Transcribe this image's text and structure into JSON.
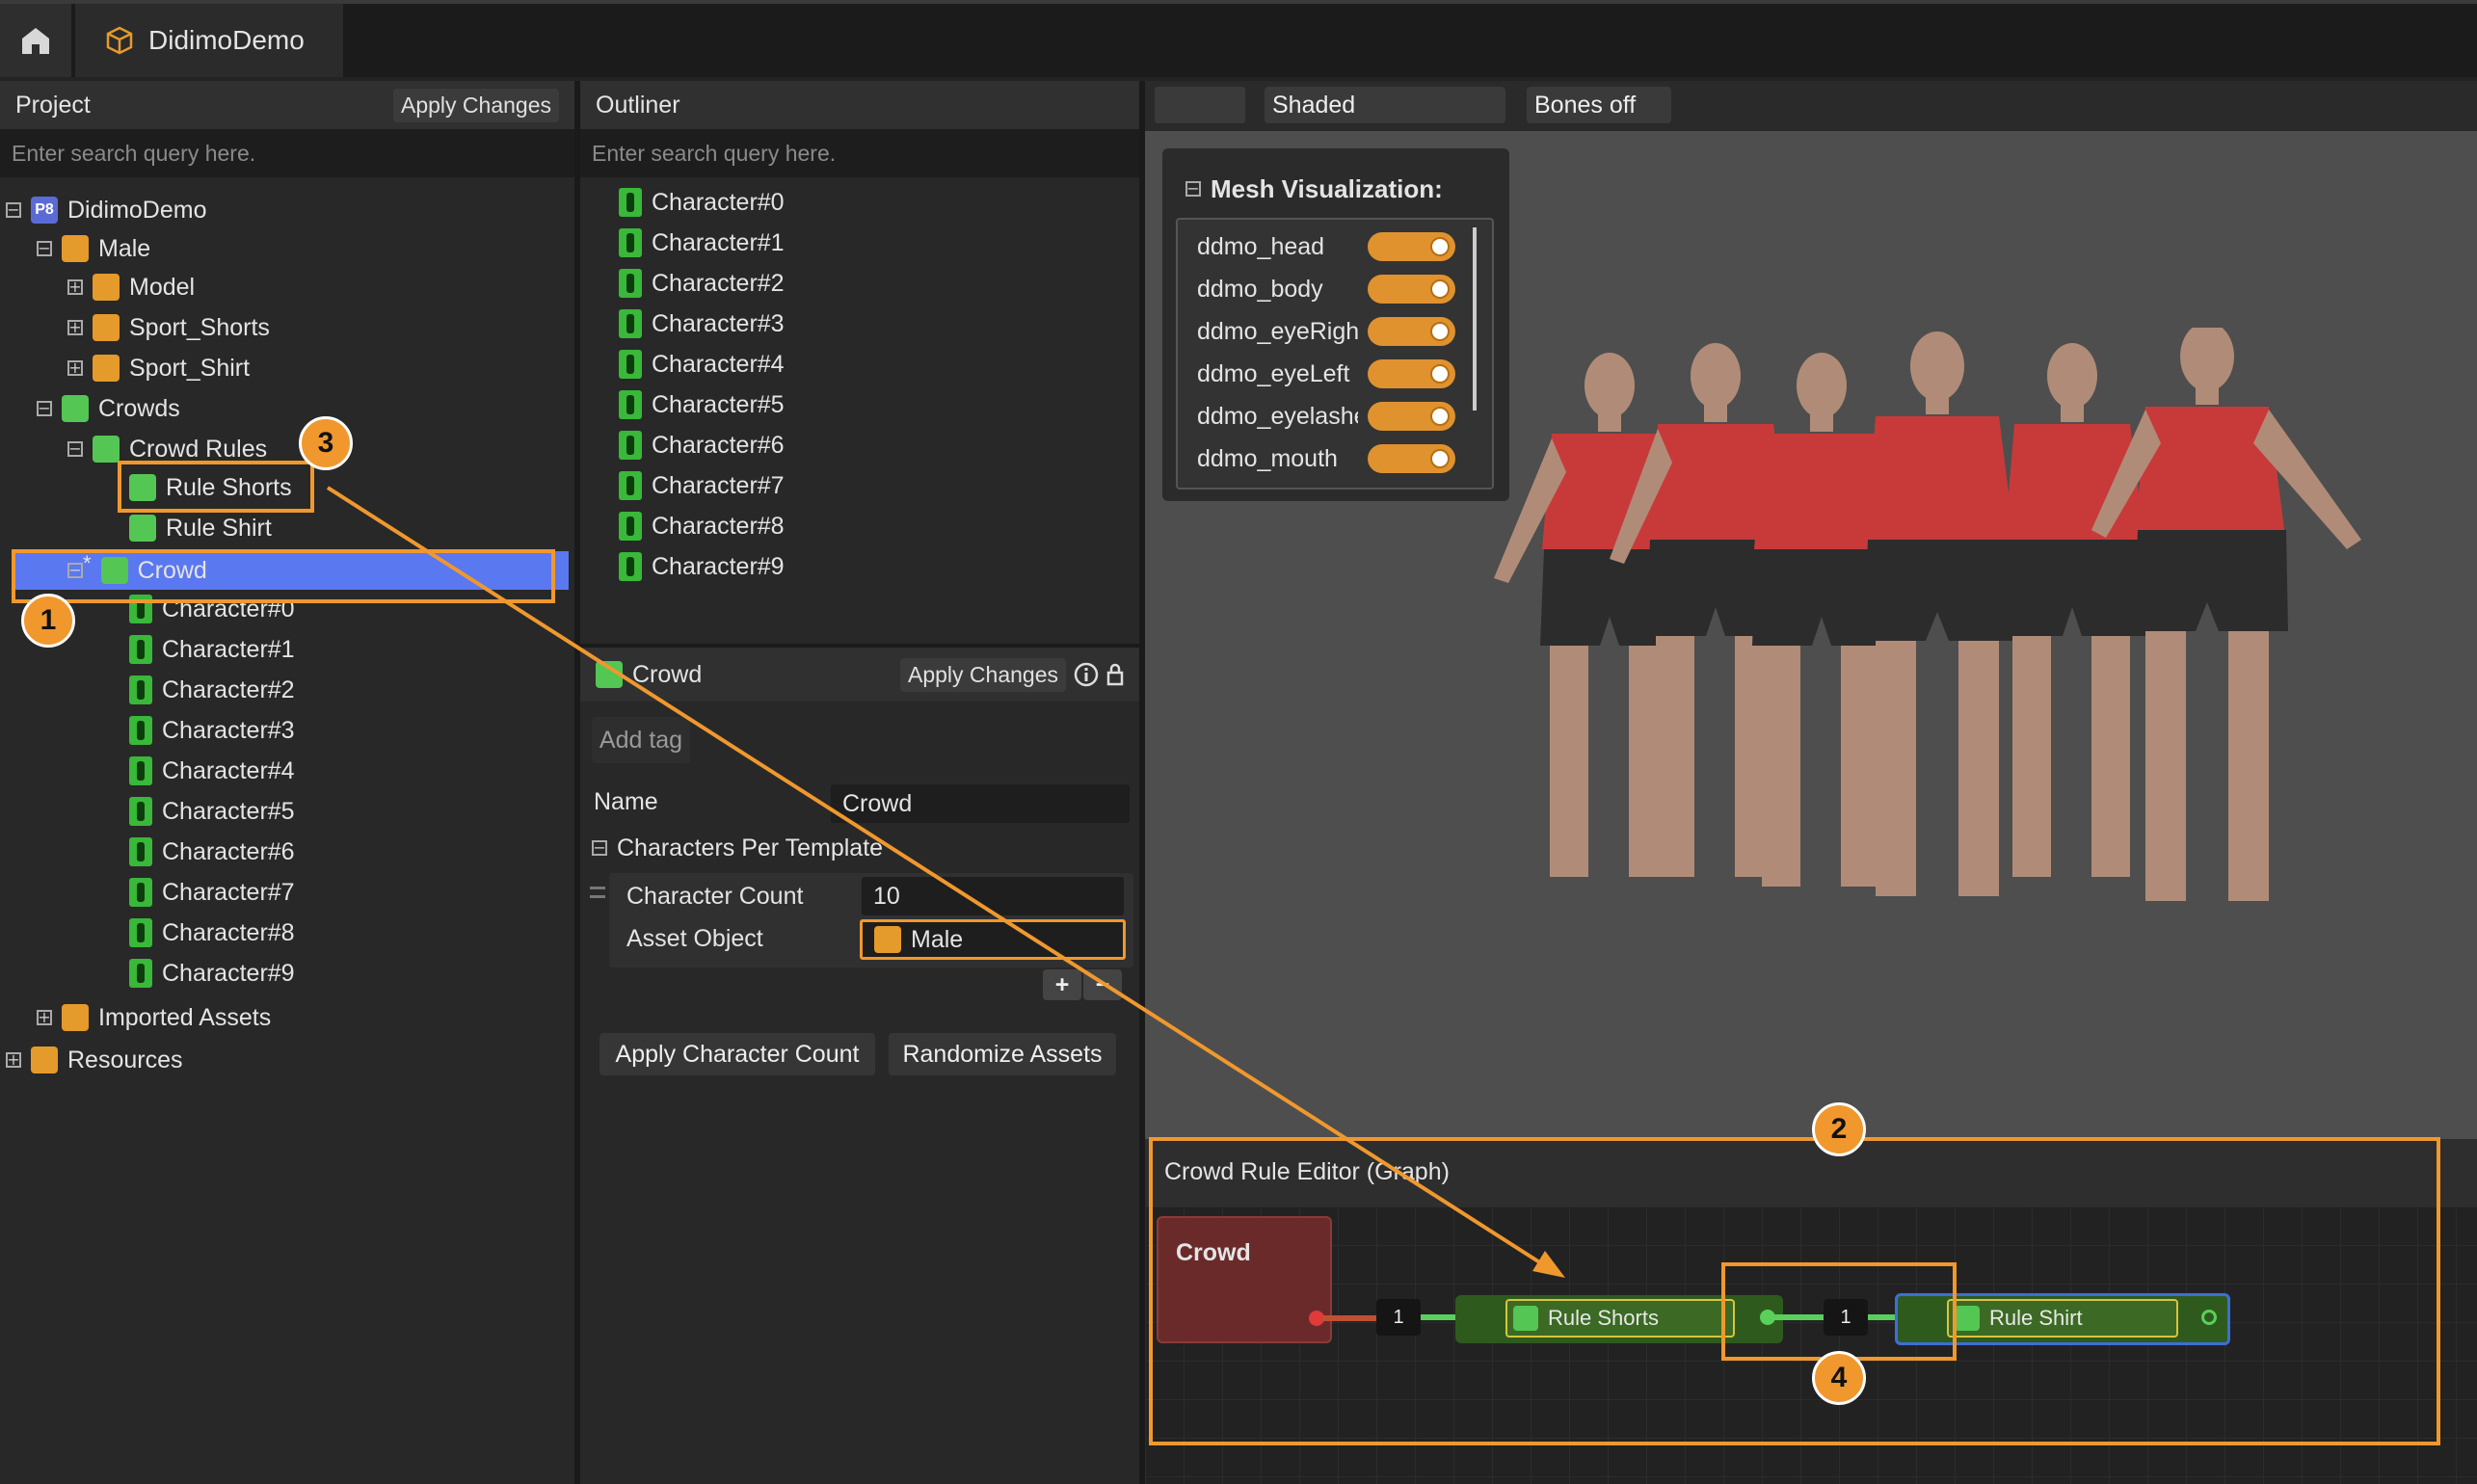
{
  "header": {
    "home_icon": "home-icon",
    "tab_title": "DidimoDemo",
    "tab_icon": "cube-icon"
  },
  "project": {
    "title": "Project",
    "apply_label": "Apply Changes",
    "search_placeholder": "Enter search query here.",
    "tree": {
      "root": "DidimoDemo",
      "root_badge": "P8",
      "male": "Male",
      "model": "Model",
      "sport_shorts": "Sport_Shorts",
      "sport_shirt": "Sport_Shirt",
      "crowds": "Crowds",
      "crowd_rules": "Crowd Rules",
      "rule_shorts": "Rule Shorts",
      "rule_shirt": "Rule Shirt",
      "crowd": "Crowd",
      "crowd_modified": "*",
      "characters": [
        "Character#0",
        "Character#1",
        "Character#2",
        "Character#3",
        "Character#4",
        "Character#5",
        "Character#6",
        "Character#7",
        "Character#8",
        "Character#9"
      ],
      "imported_assets": "Imported Assets",
      "resources": "Resources"
    }
  },
  "outliner": {
    "title": "Outliner",
    "search_placeholder": "Enter search query here.",
    "items": [
      "Character#0",
      "Character#1",
      "Character#2",
      "Character#3",
      "Character#4",
      "Character#5",
      "Character#6",
      "Character#7",
      "Character#8",
      "Character#9"
    ]
  },
  "inspector": {
    "title": "Crowd",
    "apply_label": "Apply Changes",
    "add_tag": "Add tag",
    "name_label": "Name",
    "name_value": "Crowd",
    "section": "Characters Per Template",
    "count_label": "Character Count",
    "count_value": "10",
    "asset_label": "Asset Object",
    "asset_value": "Male",
    "add_symbol": "+",
    "remove_symbol": "−",
    "apply_count_btn": "Apply Character Count",
    "randomize_btn": "Randomize Assets"
  },
  "viewport": {
    "shading": "Shaded",
    "bones": "Bones off",
    "mesh_title": "Mesh Visualization:",
    "meshes": [
      "ddmo_head",
      "ddmo_body",
      "ddmo_eyeRight",
      "ddmo_eyeLeft",
      "ddmo_eyelashe",
      "ddmo_mouth"
    ]
  },
  "graph": {
    "title": "Crowd Rule Editor (Graph)",
    "crowd_node": "Crowd",
    "link1": "1",
    "rule_shorts": "Rule Shorts",
    "link2": "1",
    "rule_shirt": "Rule Shirt"
  },
  "annotations": [
    "1",
    "2",
    "3",
    "4"
  ],
  "colors": {
    "accent": "#f0982e",
    "selection": "#5a78f0",
    "char_green": "#39b839",
    "shirt_red": "#c83a3a"
  }
}
